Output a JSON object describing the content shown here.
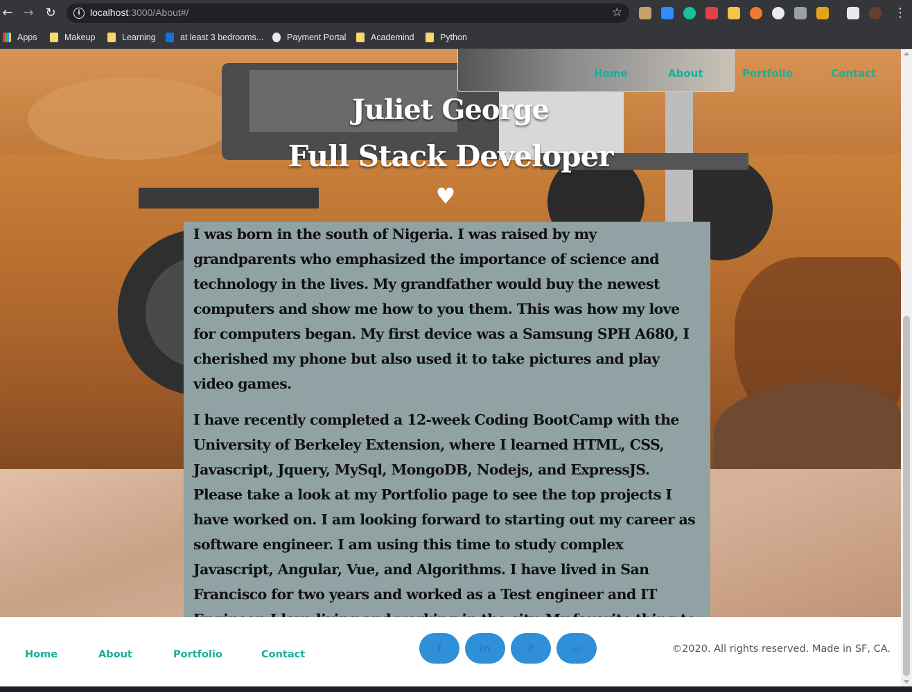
{
  "browser": {
    "url_host": "localhost",
    "url_path": ":3000/About#/",
    "bookmarks": [
      "Apps",
      "Makeup",
      "Learning",
      "at least 3 bedrooms...",
      "Payment Portal",
      "Academind",
      "Python"
    ]
  },
  "nav": {
    "items": [
      "Home",
      "About",
      "Portfolio",
      "Contact"
    ]
  },
  "hero": {
    "name": "Juliet George",
    "role": "Full Stack Developer",
    "heart": "♥"
  },
  "about": {
    "p1": "I was born in the south of Nigeria. I was raised by my grandparents who emphasized the importance of science and technology in the lives. My grandfather would buy the newest computers and show me how to you them. This was how my love for computers began. My first device was a Samsung SPH A680, I cherished my phone but also used it to take pictures and play video games.",
    "p2": "I have recently completed a 12-week Coding BootCamp with the University of Berkeley Extension, where I learned HTML, CSS, Javascript, Jquery, MySql, MongoDB, Nodejs, and ExpressJS. Please take a look at my Portfolio page to see the top projects I have worked on. I am looking forward to starting out my career as software engineer. I am using this time to study complex Javascript, Angular, Vue, and Algorithms. I have lived in San Francisco for two years and worked as a Test engineer and IT Engineer. I love living and working in the city. My favorite thing to do is checking out restaurants in North Beach with my friends."
  },
  "footer": {
    "links": [
      "Home",
      "About",
      "Portfolio",
      "Contact"
    ],
    "social": [
      {
        "icon": "facebook-icon",
        "glyph": "f"
      },
      {
        "icon": "linkedin-icon",
        "glyph": "in"
      },
      {
        "icon": "pinterest-icon",
        "glyph": "℗"
      },
      {
        "icon": "github-icon",
        "glyph": "◎"
      }
    ],
    "copyright": "©2020. All rights reserved. Made in SF, CA."
  },
  "colors": {
    "accent": "#16b09b",
    "about_bg": "#91a2a4",
    "social_bg": "#2f8fd8"
  }
}
